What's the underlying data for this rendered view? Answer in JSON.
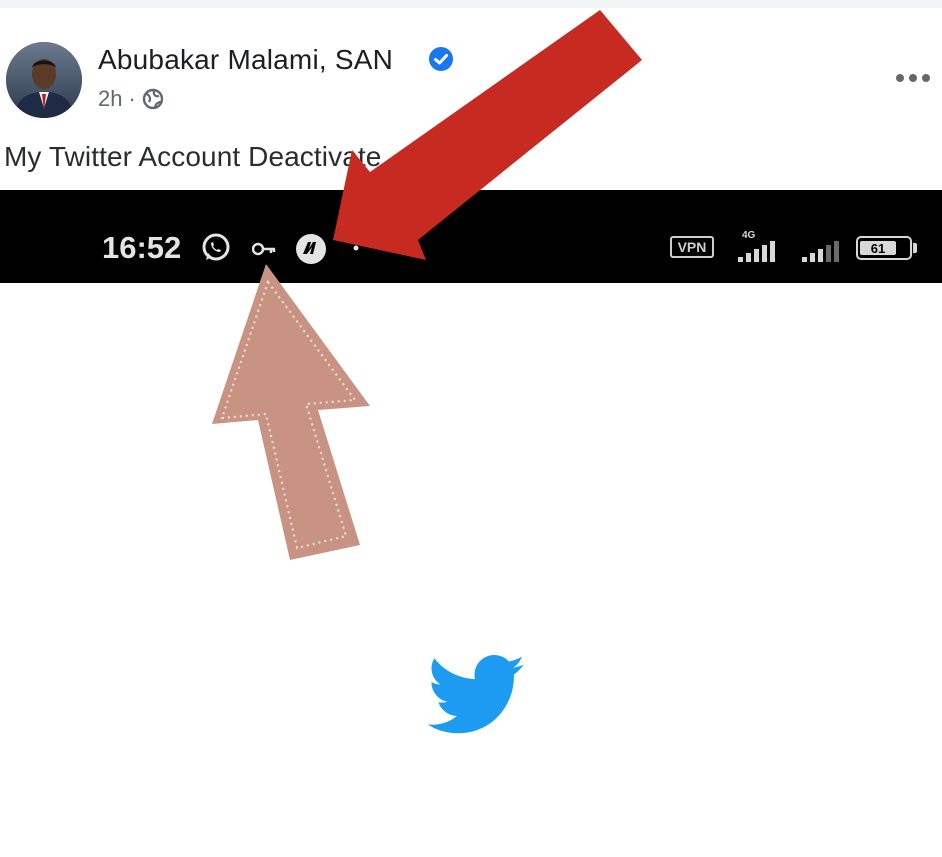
{
  "post": {
    "author": "Abubakar Malami, SAN",
    "time": "2h",
    "separator": "·",
    "text": "My Twitter Account Deactivate"
  },
  "status_bar": {
    "time": "16:52",
    "vpn_label": "VPN",
    "network_label": "4G",
    "battery": "61"
  },
  "icons": {
    "verified": "verified-badge-icon",
    "privacy": "globe-icon",
    "more": "more-options-icon",
    "whatsapp": "whatsapp-icon",
    "vpn_key": "key-icon",
    "app": "app-notification-icon",
    "twitter": "twitter-bird-icon"
  },
  "colors": {
    "status_bar_bg": "#000000",
    "verified_blue": "#1877f2",
    "twitter_blue": "#1d9bf0",
    "red_arrow": "#c62a21",
    "pink_arrow": "#c99383"
  }
}
